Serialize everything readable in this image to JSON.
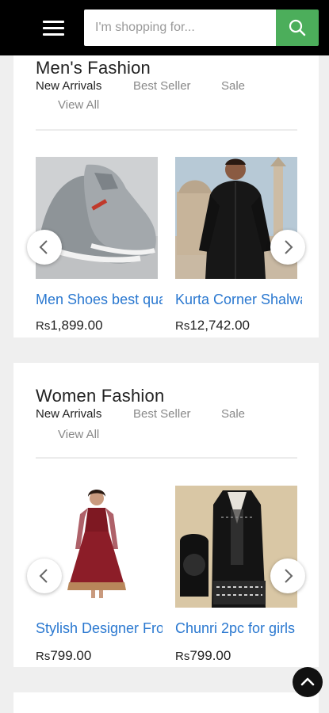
{
  "header": {
    "search_placeholder": "I'm shopping for..."
  },
  "sections": [
    {
      "title": "Men's Fashion",
      "tabs": [
        "New Arrivals",
        "Best Seller",
        "Sale",
        "View All"
      ],
      "products": [
        {
          "name": "Men Shoes best quality",
          "currency": "Rs",
          "price": "1,899.00"
        },
        {
          "name": "Kurta Corner Shalwar Kameez",
          "currency": "Rs",
          "price": "12,742.00"
        }
      ]
    },
    {
      "title": "Women Fashion",
      "tabs": [
        "New Arrivals",
        "Best Seller",
        "Sale",
        "View All"
      ],
      "products": [
        {
          "name": "Stylish Designer Frock",
          "currency": "Rs",
          "price": "799.00"
        },
        {
          "name": "Chunri 2pc for girls",
          "currency": "Rs",
          "price": "799.00"
        }
      ]
    }
  ],
  "colors": {
    "accent": "#4cae5b",
    "link": "#2a78d0",
    "header": "#000000"
  },
  "icons": [
    "menu-icon",
    "search-icon",
    "chevron-left-icon",
    "chevron-right-icon",
    "chevron-up-icon"
  ]
}
